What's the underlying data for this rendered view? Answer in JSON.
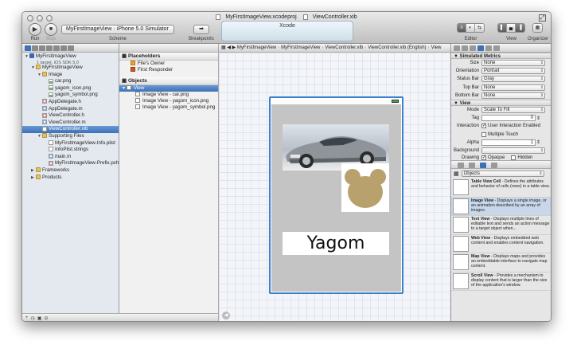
{
  "window": {
    "title_project": "MyFirstImageView.xcodeproj",
    "title_file": "ViewController.xib"
  },
  "toolbar": {
    "run_label": "Run",
    "stop_label": "Stop",
    "scheme_project": "MyFirstImageView",
    "scheme_separator": "›",
    "scheme_target": "iPhone 5.0 Simulator",
    "scheme_label": "Scheme",
    "breakpoints_label": "Breakpoints",
    "activity_text": "Xcode",
    "editor_label": "Editor",
    "view_label": "View",
    "organizer_label": "Organizer"
  },
  "navigator": {
    "project_name": "MyFirstImageView",
    "project_subtitle": "1 target, iOS SDK 5.0",
    "items": [
      {
        "label": "MyFirstImageView",
        "type": "folder",
        "indent": 1
      },
      {
        "label": "Image",
        "type": "folder",
        "indent": 2
      },
      {
        "label": "car.png",
        "type": "image",
        "indent": 3
      },
      {
        "label": "yagom_icon.png",
        "type": "image",
        "indent": 3
      },
      {
        "label": "yagom_symbol.png",
        "type": "image",
        "indent": 3
      },
      {
        "label": "AppDelegate.h",
        "type": "h",
        "indent": 2
      },
      {
        "label": "AppDelegate.m",
        "type": "m",
        "indent": 2
      },
      {
        "label": "ViewController.h",
        "type": "h",
        "indent": 2
      },
      {
        "label": "ViewController.m",
        "type": "m",
        "indent": 2
      },
      {
        "label": "ViewController.xib",
        "type": "xib",
        "indent": 2,
        "selected": true
      },
      {
        "label": "Supporting Files",
        "type": "folder",
        "indent": 2
      },
      {
        "label": "MyFirstImageView-Info.plist",
        "type": "file",
        "indent": 3
      },
      {
        "label": "InfoPlist.strings",
        "type": "file",
        "indent": 3
      },
      {
        "label": "main.m",
        "type": "m",
        "indent": 3
      },
      {
        "label": "MyFirstImageView-Prefix.pch",
        "type": "h",
        "indent": 3
      },
      {
        "label": "Frameworks",
        "type": "folder",
        "indent": 1
      },
      {
        "label": "Products",
        "type": "folder",
        "indent": 1
      }
    ]
  },
  "jumpbar": {
    "crumbs": [
      "MyFirstImageView",
      "MyFirstImageView",
      "ViewController.xib",
      "ViewController.xib (English)",
      "View"
    ]
  },
  "outline": {
    "placeholders_title": "Placeholders",
    "files_owner": "File's Owner",
    "first_responder": "First Responder",
    "objects_title": "Objects",
    "view_label": "View",
    "subviews": [
      "Image View - car.png",
      "Image View - yagom_icon.png",
      "Image View - yagom_symbol.png"
    ]
  },
  "canvas": {
    "logo_text": "Yagom"
  },
  "inspector": {
    "simulated_metrics_title": "Simulated Metrics",
    "size_label": "Size",
    "size_value": "None",
    "orientation_label": "Orientation",
    "orientation_value": "Portrait",
    "statusbar_label": "Status Bar",
    "statusbar_value": "Gray",
    "topbar_label": "Top Bar",
    "topbar_value": "None",
    "bottombar_label": "Bottom Bar",
    "bottombar_value": "None",
    "view_title": "View",
    "mode_label": "Mode",
    "mode_value": "Scale To Fill",
    "tag_label": "Tag",
    "tag_value": "0",
    "interaction_label": "Interaction",
    "user_interaction_label": "User Interaction Enabled",
    "multiple_touch_label": "Multiple Touch",
    "alpha_label": "Alpha",
    "alpha_value": "1",
    "background_label": "Background",
    "drawing_label": "Drawing",
    "opaque_label": "Opaque",
    "hidden_label": "Hidden"
  },
  "library": {
    "selector_value": "Objects",
    "items": [
      {
        "name": "Table View Cell",
        "desc": "- Defines the attributes and behavior of cells (rows) in a table view."
      },
      {
        "name": "Image View",
        "desc": "- Displays a single image, or an animation described by an array of images.",
        "selected": true
      },
      {
        "name": "Text View",
        "desc": "- Displays multiple lines of editable text and sends an action message to a target object when..."
      },
      {
        "name": "Web View",
        "desc": "- Displays embedded web content and enables content navigation."
      },
      {
        "name": "Map View",
        "desc": "- Displays maps and provides an embeddable interface to navigate map content."
      },
      {
        "name": "Scroll View",
        "desc": "- Provides a mechanism to display content that is larger than the size of the application's window."
      }
    ]
  }
}
